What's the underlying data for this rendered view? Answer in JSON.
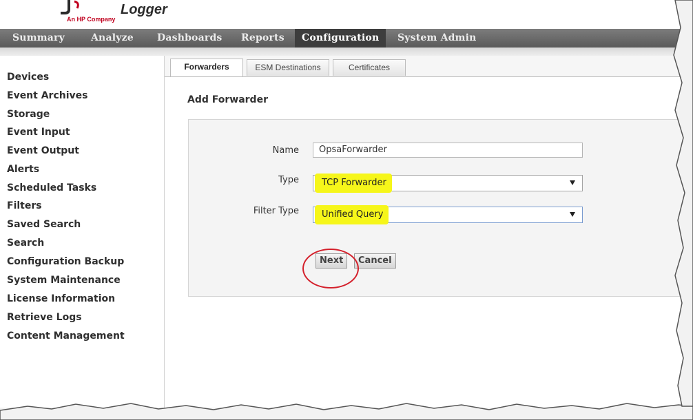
{
  "header": {
    "logo_subtitle": "An HP Company",
    "product_name": "Logger"
  },
  "nav": {
    "items": [
      "Summary",
      "Analyze",
      "Dashboards",
      "Reports",
      "Configuration",
      "System Admin"
    ],
    "active": "Configuration"
  },
  "sidebar": {
    "items": [
      "Devices",
      "Event Archives",
      "Storage",
      "Event Input",
      "Event Output",
      "Alerts",
      "Scheduled Tasks",
      "Filters",
      "Saved Search",
      "Search",
      "Configuration Backup",
      "System Maintenance",
      "License Information",
      "Retrieve Logs",
      "Content Management"
    ]
  },
  "tabs": {
    "items": [
      "Forwarders",
      "ESM Destinations",
      "Certificates"
    ],
    "active": "Forwarders"
  },
  "form": {
    "title": "Add Forwarder",
    "name_label": "Name",
    "name_value": "OpsaForwarder",
    "type_label": "Type",
    "type_value": "TCP Forwarder",
    "filter_type_label": "Filter Type",
    "filter_type_value": "Unified Query",
    "next_label": "Next",
    "cancel_label": "Cancel"
  },
  "colors": {
    "highlight": "#f6f61a",
    "annotation_circle": "#d4202b",
    "nav_background": "#666666"
  }
}
